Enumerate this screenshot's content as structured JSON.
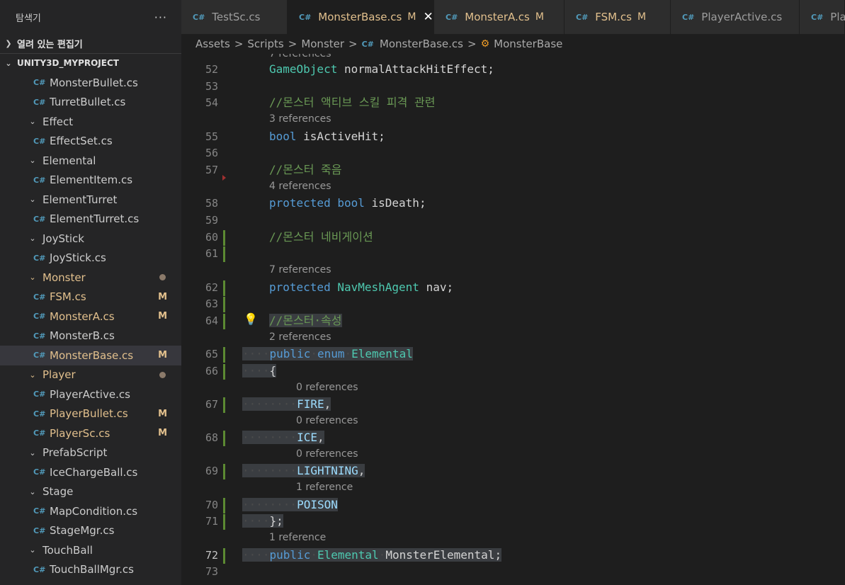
{
  "explorer": {
    "title": "탐색기",
    "more": "···",
    "open_editors": "열려 있는 편집기",
    "project": "UNITY3D_MYPROJECT"
  },
  "tree": [
    {
      "kind": "file",
      "label": "MonsterBullet.cs"
    },
    {
      "kind": "file",
      "label": "TurretBullet.cs"
    },
    {
      "kind": "folder",
      "label": "Effect"
    },
    {
      "kind": "file",
      "label": "EffectSet.cs"
    },
    {
      "kind": "folder",
      "label": "Elemental"
    },
    {
      "kind": "file",
      "label": "ElementItem.cs"
    },
    {
      "kind": "folder",
      "label": "ElementTurret"
    },
    {
      "kind": "file",
      "label": "ElementTurret.cs"
    },
    {
      "kind": "folder",
      "label": "JoyStick"
    },
    {
      "kind": "file",
      "label": "JoyStick.cs"
    },
    {
      "kind": "folder",
      "label": "Monster",
      "modified": true,
      "dot": true
    },
    {
      "kind": "file",
      "label": "FSM.cs",
      "modified": true,
      "badge": "M"
    },
    {
      "kind": "file",
      "label": "MonsterA.cs",
      "modified": true,
      "badge": "M"
    },
    {
      "kind": "file",
      "label": "MonsterB.cs"
    },
    {
      "kind": "file",
      "label": "MonsterBase.cs",
      "modified": true,
      "badge": "M",
      "selected": true
    },
    {
      "kind": "folder",
      "label": "Player",
      "modified": true,
      "dot": true
    },
    {
      "kind": "file",
      "label": "PlayerActive.cs"
    },
    {
      "kind": "file",
      "label": "PlayerBullet.cs",
      "modified": true,
      "badge": "M"
    },
    {
      "kind": "file",
      "label": "PlayerSc.cs",
      "modified": true,
      "badge": "M"
    },
    {
      "kind": "folder",
      "label": "PrefabScript"
    },
    {
      "kind": "file",
      "label": "IceChargeBall.cs"
    },
    {
      "kind": "folder",
      "label": "Stage"
    },
    {
      "kind": "file",
      "label": "MapCondition.cs"
    },
    {
      "kind": "file",
      "label": "StageMgr.cs"
    },
    {
      "kind": "folder",
      "label": "TouchBall"
    },
    {
      "kind": "file",
      "label": "TouchBallMgr.cs"
    }
  ],
  "tabs": [
    {
      "label": "TestSc.cs",
      "badge": ""
    },
    {
      "label": "MonsterBase.cs",
      "badge": "M",
      "active": true,
      "close": "✕"
    },
    {
      "label": "MonsterA.cs",
      "badge": "M"
    },
    {
      "label": "FSM.cs",
      "badge": "M"
    },
    {
      "label": "PlayerActive.cs",
      "badge": ""
    },
    {
      "label": "Play",
      "badge": ""
    }
  ],
  "breadcrumb": {
    "assets": "Assets",
    "scripts": "Scripts",
    "monster": "Monster",
    "file": "MonsterBase.cs",
    "symbol": "MonsterBase",
    "sep": ">"
  },
  "editor": {
    "lens_top": "7 references",
    "lines": [
      {
        "n": "52",
        "code": [
          [
            "ty",
            "GameObject"
          ],
          [
            "pl",
            " "
          ],
          [
            "pl",
            "normalAttackHitEffect;"
          ]
        ]
      },
      {
        "n": "53",
        "code": []
      },
      {
        "n": "54",
        "code": [
          [
            "cm",
            "//몬스터 액티브 스킬 피격 관련"
          ]
        ]
      },
      {
        "lens": "3 references"
      },
      {
        "n": "55",
        "code": [
          [
            "kw",
            "bool"
          ],
          [
            "pl",
            " isActiveHit;"
          ]
        ]
      },
      {
        "n": "56",
        "code": []
      },
      {
        "n": "57",
        "code": [
          [
            "cm",
            "//몬스터 죽음"
          ]
        ]
      },
      {
        "lens": "4 references"
      },
      {
        "n": "58",
        "code": [
          [
            "kw",
            "protected"
          ],
          [
            "pl",
            " "
          ],
          [
            "kw",
            "bool"
          ],
          [
            "pl",
            " isDeath;"
          ]
        ]
      },
      {
        "n": "59",
        "code": []
      },
      {
        "n": "60",
        "code": [
          [
            "cm",
            "//몬스터 네비게이션"
          ]
        ],
        "bar": true
      },
      {
        "n": "61",
        "code": [],
        "bar": true
      },
      {
        "lens": "7 references"
      },
      {
        "n": "62",
        "code": [
          [
            "kw",
            "protected"
          ],
          [
            "pl",
            " "
          ],
          [
            "ty",
            "NavMeshAgent"
          ],
          [
            "pl",
            " nav;"
          ]
        ],
        "bar": true
      },
      {
        "n": "63",
        "code": [],
        "bar": true
      },
      {
        "n": "64",
        "code": [
          [
            "cm",
            "//몬스터·속성"
          ]
        ],
        "bar": true,
        "bulb": "💡",
        "hl": true
      },
      {
        "lens": "2 references"
      },
      {
        "n": "65",
        "code": [
          [
            "ws",
            "····"
          ],
          [
            "kw",
            "public"
          ],
          [
            "ws",
            "·"
          ],
          [
            "kw",
            "enum"
          ],
          [
            "ws",
            "·"
          ],
          [
            "ty",
            "Elemental"
          ]
        ],
        "bar": true,
        "hl": true
      },
      {
        "n": "66",
        "code": [
          [
            "ws",
            "····"
          ],
          [
            "pl",
            "{"
          ]
        ],
        "bar": true,
        "hl": true
      },
      {
        "lens": "0 references",
        "indent": true
      },
      {
        "n": "67",
        "code": [
          [
            "ws",
            "········"
          ],
          [
            "id",
            "FIRE"
          ],
          [
            "pl",
            ","
          ]
        ],
        "bar": true,
        "hl": true
      },
      {
        "lens": "0 references",
        "indent": true
      },
      {
        "n": "68",
        "code": [
          [
            "ws",
            "········"
          ],
          [
            "id",
            "ICE"
          ],
          [
            "pl",
            ","
          ]
        ],
        "bar": true,
        "hl": true
      },
      {
        "lens": "0 references",
        "indent": true
      },
      {
        "n": "69",
        "code": [
          [
            "ws",
            "········"
          ],
          [
            "id",
            "LIGHTNING"
          ],
          [
            "pl",
            ","
          ]
        ],
        "bar": true,
        "hl": true
      },
      {
        "lens": "1 reference",
        "indent": true
      },
      {
        "n": "70",
        "code": [
          [
            "ws",
            "········"
          ],
          [
            "id",
            "POISON"
          ]
        ],
        "bar": true,
        "hl": true
      },
      {
        "n": "71",
        "code": [
          [
            "ws",
            "····"
          ],
          [
            "pl",
            "};"
          ]
        ],
        "bar": true,
        "hl": true
      },
      {
        "lens": "1 reference"
      },
      {
        "n": "72",
        "code": [
          [
            "ws",
            "····"
          ],
          [
            "kw",
            "public"
          ],
          [
            "ws",
            "·"
          ],
          [
            "ty",
            "Elemental"
          ],
          [
            "ws",
            "·"
          ],
          [
            "pl",
            "MonsterElemental;"
          ]
        ],
        "bar": true,
        "hl": true,
        "cur": true
      },
      {
        "n": "73",
        "code": []
      }
    ]
  }
}
